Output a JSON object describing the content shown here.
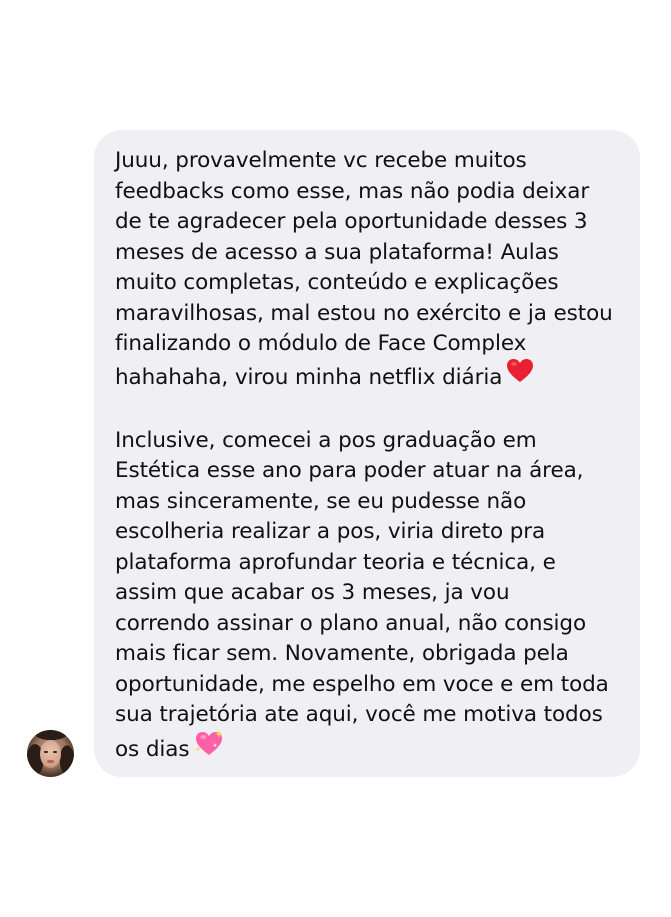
{
  "message": {
    "paragraph_1": "Juuu, provavelmente vc recebe muitos\nfeedbacks como esse, mas não podia deixar\nde te agradecer pela oportunidade desses 3\nmeses de acesso a sua plataforma! Aulas\nmuito completas, conteúdo e explicações\nmaravilhosas, mal estou no exército e ja estou\nfinalizando o módulo de Face Complex\nhahahaha, virou minha netflix diária",
    "paragraph_1_emoji": "red-heart-icon",
    "paragraph_2": "Inclusive, comecei a pos graduação em\nEstética esse ano para poder atuar na área,\nmas sinceramente, se eu pudesse não\nescolheria realizar a pos, viria direto pra\nplataforma aprofundar teoria e técnica, e\nassim que acabar os 3 meses, ja vou\ncorrendo assinar o plano anual, não consigo\nmais ficar sem. Novamente, obrigada pela\noportunidade, me espelho em voce e em toda\nsua trajetória ate aqui, você me motiva todos\nos dias",
    "paragraph_2_emoji": "sparkling-heart-icon"
  },
  "colors": {
    "bubble_background": "#efeff4",
    "text": "#111111",
    "heart_red": "#e8202f",
    "sparkle_heart_pink": "#ff5fa8"
  }
}
